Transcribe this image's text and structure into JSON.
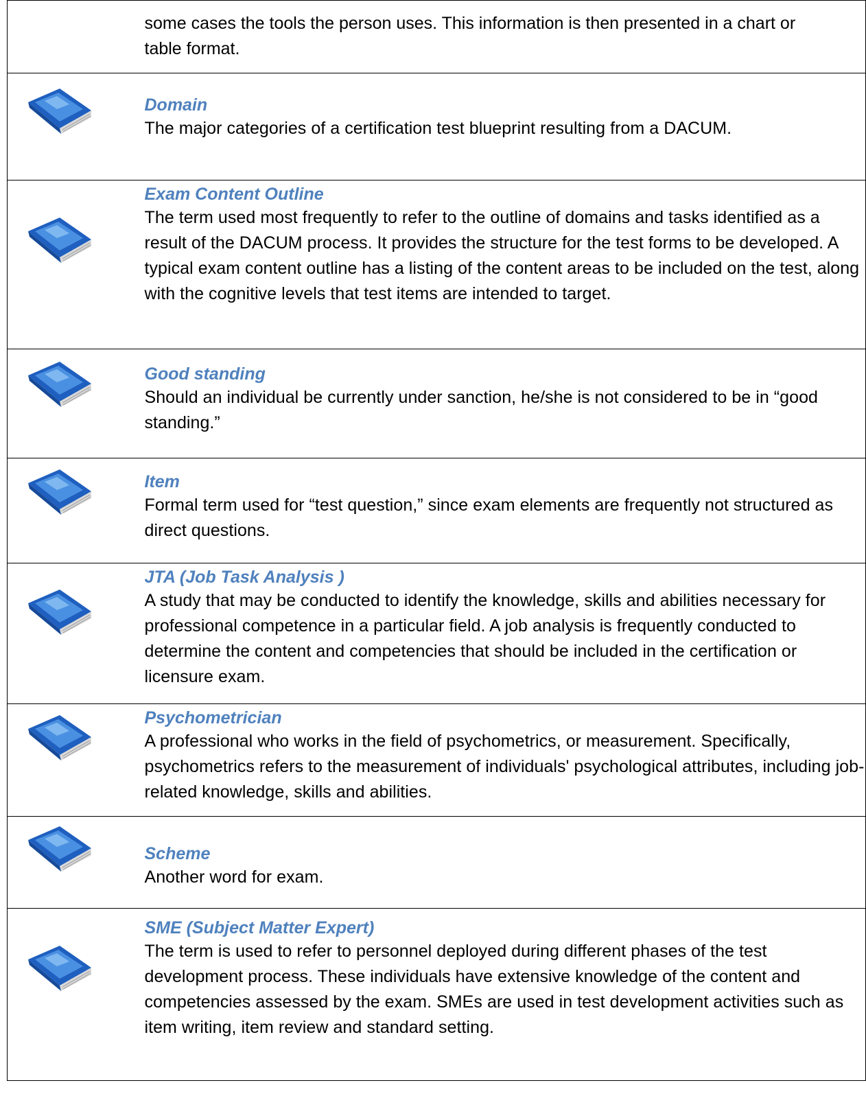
{
  "continuation_text": "some cases the tools the person uses.  This information is then presented in a chart or table format.",
  "entries": [
    {
      "term": "Domain",
      "definition": "The major categories of a certification test blueprint resulting from a DACUM."
    },
    {
      "term": "Exam Content Outline",
      "definition": "The term used most frequently to refer to the outline of domains and tasks identified as a result of the DACUM process. It provides the structure for the test forms to be developed.  A typical exam content outline has a listing of the content areas to be included on the test, along with the cognitive levels that test items are intended to target."
    },
    {
      "term": "Good standing",
      "definition": "Should an individual be currently under sanction, he/she is not considered to be in “good standing.”"
    },
    {
      "term": "Item",
      "definition": "Formal term used for “test question,” since exam elements are frequently not structured as direct questions."
    },
    {
      "term": "JTA (Job Task Analysis )",
      "definition": "A study that may be conducted to identify the knowledge, skills and abilities necessary for professional competence in a particular field.  A job analysis is frequently conducted to determine the content and competencies that should be included in the certification or licensure exam."
    },
    {
      "term": "Psychometrician",
      "definition": "A professional who works in the field of psychometrics, or measurement. Specifically, psychometrics refers to the measurement of individuals' psychological attributes, including job-related knowledge, skills and abilities."
    },
    {
      "term": "Scheme",
      "definition": "Another word for exam."
    },
    {
      "term": "SME (Subject Matter Expert)",
      "definition": "The term is used to refer to personnel deployed during different phases of the test development process.  These individuals have extensive knowledge of the content and competencies assessed by the exam.  SMEs are used in test development activities such as item writing, item review and standard setting."
    }
  ],
  "icon": "book-icon",
  "colors": {
    "term": "#4f81bd",
    "book_cover": "#1f5fbf",
    "book_light": "#5aa0ea",
    "book_pages": "#e6e6e6"
  }
}
